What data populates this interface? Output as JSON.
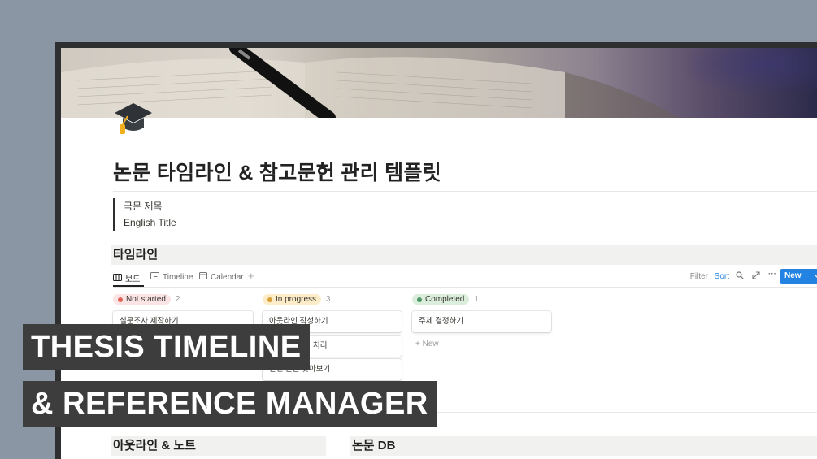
{
  "page": {
    "title": "논문 타임라인 & 참고문헌 관리 템플릿",
    "icon": "graduation-cap-icon",
    "cover": "open-book-and-pen-cover"
  },
  "quote": {
    "line1": "국문 제목",
    "line2": "English Title"
  },
  "timeline_section": {
    "heading": "타임라인"
  },
  "views": {
    "tabs": [
      {
        "label": "보드",
        "icon": "board-icon",
        "active": true
      },
      {
        "label": "Timeline",
        "icon": "timeline-icon",
        "active": false
      },
      {
        "label": "Calendar",
        "icon": "calendar-icon",
        "active": false
      }
    ],
    "add_view": "+",
    "toolbar": {
      "filter": "Filter",
      "sort": "Sort",
      "search_icon": "search-icon",
      "expand_icon": "expand-icon",
      "more": "···",
      "new": "New",
      "new_chevron": "chevron-down-icon"
    }
  },
  "board": {
    "columns": [
      {
        "status": "Not started",
        "count": "2",
        "pill_color": "#fbe4e4",
        "dot_color": "#e16259",
        "cards": [
          "설문조사 제작하기"
        ]
      },
      {
        "status": "In progress",
        "count": "3",
        "pill_color": "#fdecc8",
        "dot_color": "#d9a13a",
        "cards": [
          "아웃라인 작성하기",
          "처리",
          "관련 논문 찾아보기"
        ]
      },
      {
        "status": "Completed",
        "count": "1",
        "pill_color": "#dbeddb",
        "dot_color": "#4f9768",
        "cards": [
          "주제 결정하기"
        ],
        "add_new": "+ New"
      }
    ]
  },
  "bottom_sections": {
    "outline": "아웃라인 & 노트",
    "papers": "논문 DB"
  },
  "overlay": {
    "line1": "THESIS TIMELINE",
    "line2": "& REFERENCE MANAGER"
  },
  "colors": {
    "accent": "#2383e2",
    "overlay_bg": "#3d3d3d",
    "background": "#8a96a3"
  }
}
